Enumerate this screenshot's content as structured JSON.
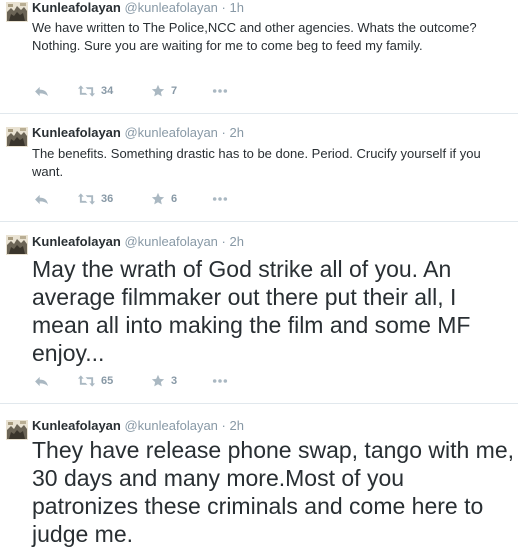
{
  "tweets": [
    {
      "name": "Kunleafolayan",
      "handle": "@kunleafolayan",
      "separator": "·",
      "time": "1h",
      "text": "We have written to The Police,NCC and other agencies. Whats the outcome?Nothing. Sure you are waiting for me to come beg to feed my family.",
      "retweets": "34",
      "favorites": "7"
    },
    {
      "name": "Kunleafolayan",
      "handle": "@kunleafolayan",
      "separator": "·",
      "time": "2h",
      "text": "The benefits. Something drastic has to be done. Period. Crucify yourself if you want.",
      "retweets": "36",
      "favorites": "6"
    },
    {
      "name": "Kunleafolayan",
      "handle": "@kunleafolayan",
      "separator": "·",
      "time": "2h",
      "text": "May the wrath of God strike all of you. An average filmmaker out there put their all, I mean all into making the film and some MF enjoy...",
      "retweets": "65",
      "favorites": "3"
    },
    {
      "name": "Kunleafolayan",
      "handle": "@kunleafolayan",
      "separator": "·",
      "time": "2h",
      "text": "They have release phone swap, tango with me, 30 days and many more.Most of you patronizes these criminals and come here to judge me."
    }
  ],
  "icons": {
    "reply": "reply-icon",
    "retweet": "retweet-icon",
    "favorite": "star-icon",
    "more": "more-icon"
  },
  "colors": {
    "name": "#292f33",
    "meta": "#8899a6",
    "action": "#aab8c2",
    "divider": "#e1e8ed"
  }
}
